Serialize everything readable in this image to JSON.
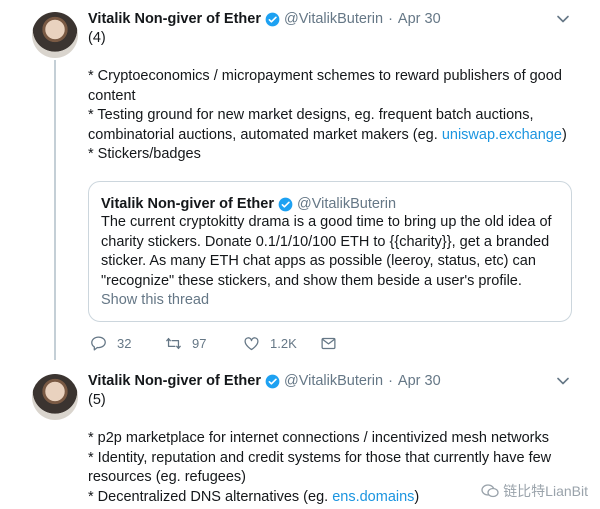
{
  "tweets": [
    {
      "display_name": "Vitalik Non-giver of Ether",
      "handle": "@VitalikButerin",
      "separator": "·",
      "date": "Apr 30",
      "number": "(4)",
      "lines": [
        "* Cryptoeconomics / micropayment schemes to reward publishers of good content",
        "* Testing ground for new market designs, eg. frequent batch auctions, combinatorial auctions, automated market makers (eg. ",
        "uniswap.exchange",
        ")",
        "* Stickers/badges"
      ],
      "quote": {
        "display_name": "Vitalik Non-giver of Ether",
        "handle": "@VitalikButerin",
        "text": "The current cryptokitty drama is a good time to bring up the old idea of charity stickers. Donate 0.1/1/10/100 ETH to {{charity}}, get a branded sticker. As many ETH chat apps as possible (leeroy, status, etc) can \"recognize\" these stickers, and show them beside a user's profile.",
        "show_thread": "Show this thread"
      },
      "actions": {
        "replies": "32",
        "retweets": "97",
        "likes": "1.2K"
      }
    },
    {
      "display_name": "Vitalik Non-giver of Ether",
      "handle": "@VitalikButerin",
      "separator": "·",
      "date": "Apr 30",
      "number": "(5)",
      "lines": [
        "* p2p marketplace for internet connections / incentivized mesh networks",
        "* Identity, reputation and credit systems for those that currently have few resources (eg. refugees)",
        "* Decentralized DNS alternatives (eg. ",
        "ens.domains",
        ")"
      ]
    }
  ],
  "watermark": "链比特LianBit",
  "colors": {
    "text": "#14171a",
    "secondary": "#657786",
    "link": "#1b95e0",
    "verified": "#1da1f2",
    "border": "#ccd6dd"
  },
  "icons": [
    "verified-badge-icon",
    "chevron-down-icon",
    "reply-icon",
    "retweet-icon",
    "like-icon",
    "direct-message-icon",
    "wechat-icon"
  ]
}
